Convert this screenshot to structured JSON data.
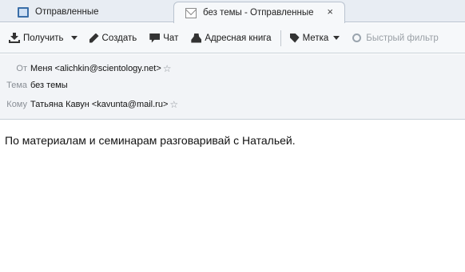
{
  "tabs": [
    {
      "label": "Отправленные",
      "icon": "folder-icon"
    },
    {
      "label": "без темы - Отправленные",
      "icon": "mail-icon",
      "close": "×"
    }
  ],
  "toolbar": {
    "get_label": "Получить",
    "compose_label": "Создать",
    "chat_label": "Чат",
    "addressbook_label": "Адресная книга",
    "tag_label": "Метка",
    "quickfilter_label": "Быстрый фильтр"
  },
  "header": {
    "from_label": "От",
    "from_value": "Меня <alichkin@scientology.net>",
    "subject_label": "Тема",
    "subject_value": "без темы",
    "to_label": "Кому",
    "to_value": "Татьяна Кавун <kavunta@mail.ru>",
    "star": "☆"
  },
  "body": {
    "text": "По материалам и семинарам разговаривай с Натальей."
  },
  "colors": {
    "tabbar_bg": "#e8edf3",
    "header_bg": "#f2f4f7",
    "label_gray": "#8a8f96"
  }
}
